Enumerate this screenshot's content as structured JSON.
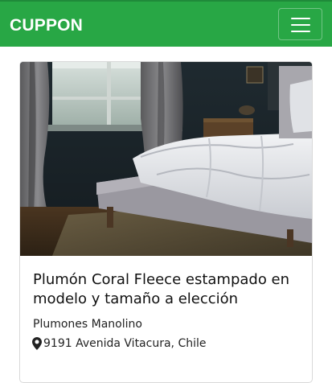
{
  "navbar": {
    "brand": "CUPPON",
    "toggle_icon": "hamburger-menu-icon",
    "color": "#28a745"
  },
  "card": {
    "image": "bed-photo",
    "title": "Plumón Coral Fleece estampado en modelo y tamaño a elección",
    "seller": "Plumones Manolino",
    "location_icon": "map-marker-icon",
    "location": "9191 Avenida Vitacura, Chile"
  }
}
